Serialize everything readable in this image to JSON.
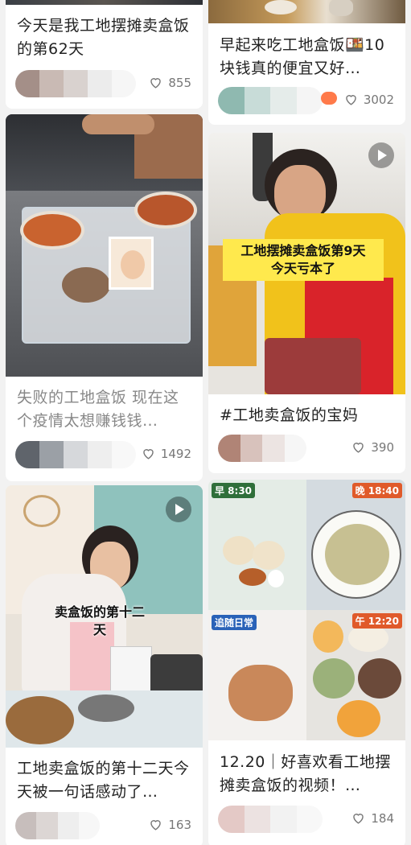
{
  "cards": [
    {
      "title": "今天是我工地摆摊卖盒饭的第62天",
      "likes": "855"
    },
    {
      "title": "早起来吃工地盒饭🍱10块钱真的便宜又好…",
      "likes": "3002"
    },
    {
      "title": "失败的工地盒饭 现在这个疫情太想赚钱钱…",
      "likes": "1492"
    },
    {
      "title": "#工地卖盒饭的宝妈",
      "likes": "390",
      "caption": "工地摆摊卖盒饭第9天\n今天亏本了"
    },
    {
      "title": "工地卖盒饭的第十二天今天被一句话感动了…",
      "likes": "163",
      "caption": "卖盒饭的第十二天"
    },
    {
      "title": "12.20｜好喜欢看工地摆摊卖盒饭的视频！…",
      "likes": "184",
      "labels": {
        "breakfast": "早 8:30",
        "lunch": "晚 18:40",
        "daily": "追随日常",
        "noon": "午 12:20"
      }
    }
  ],
  "icons": {
    "like": "heart-outline-icon",
    "play": "play-icon"
  },
  "colors": {
    "background": "#f2f2f2",
    "card": "#ffffff",
    "title": "#222222",
    "muted": "#888888",
    "caption": "#ffe94d"
  }
}
